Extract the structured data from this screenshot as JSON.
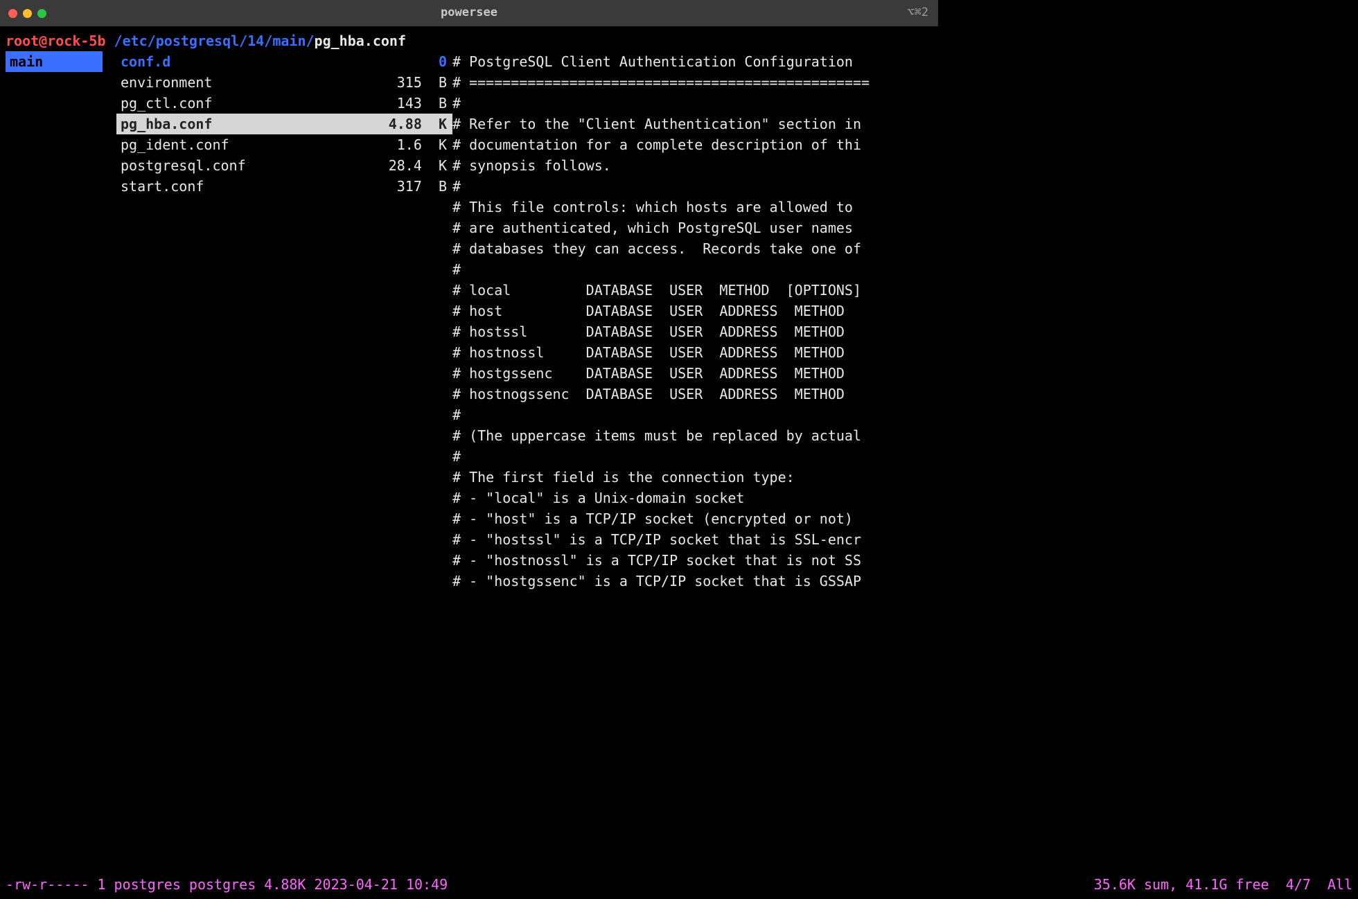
{
  "titlebar": {
    "title": "powersee",
    "right_indicator": "⌥⌘2"
  },
  "prompt": {
    "user": "root@rock-5b",
    "path": " /etc/postgresql/14/main/",
    "current_file": "pg_hba.conf"
  },
  "left_col": {
    "selected_dir": "main"
  },
  "files": [
    {
      "name": "conf.d",
      "size": "0",
      "is_dir": true,
      "selected": false
    },
    {
      "name": "environment",
      "size": "315  B",
      "is_dir": false,
      "selected": false
    },
    {
      "name": "pg_ctl.conf",
      "size": "143  B",
      "is_dir": false,
      "selected": false
    },
    {
      "name": "pg_hba.conf",
      "size": "4.88  K",
      "is_dir": false,
      "selected": true
    },
    {
      "name": "pg_ident.conf",
      "size": "1.6  K",
      "is_dir": false,
      "selected": false
    },
    {
      "name": "postgresql.conf",
      "size": "28.4  K",
      "is_dir": false,
      "selected": false
    },
    {
      "name": "start.conf",
      "size": "317  B",
      "is_dir": false,
      "selected": false
    }
  ],
  "preview_lines": [
    "# PostgreSQL Client Authentication Configuration",
    "# ================================================",
    "#",
    "# Refer to the \"Client Authentication\" section in",
    "# documentation for a complete description of thi",
    "# synopsis follows.",
    "#",
    "# This file controls: which hosts are allowed to ",
    "# are authenticated, which PostgreSQL user names ",
    "# databases they can access.  Records take one of",
    "#",
    "# local         DATABASE  USER  METHOD  [OPTIONS]",
    "# host          DATABASE  USER  ADDRESS  METHOD  ",
    "# hostssl       DATABASE  USER  ADDRESS  METHOD  ",
    "# hostnossl     DATABASE  USER  ADDRESS  METHOD  ",
    "# hostgssenc    DATABASE  USER  ADDRESS  METHOD  ",
    "# hostnogssenc  DATABASE  USER  ADDRESS  METHOD  ",
    "#",
    "# (The uppercase items must be replaced by actual",
    "#",
    "# The first field is the connection type:",
    "# - \"local\" is a Unix-domain socket",
    "# - \"host\" is a TCP/IP socket (encrypted or not)",
    "# - \"hostssl\" is a TCP/IP socket that is SSL-encr",
    "# - \"hostnossl\" is a TCP/IP socket that is not SS",
    "# - \"hostgssenc\" is a TCP/IP socket that is GSSAP"
  ],
  "status": {
    "left": "-rw-r----- 1 postgres postgres 4.88K 2023-04-21 10:49",
    "right": "35.6K sum, 41.1G free  4/7  All"
  }
}
